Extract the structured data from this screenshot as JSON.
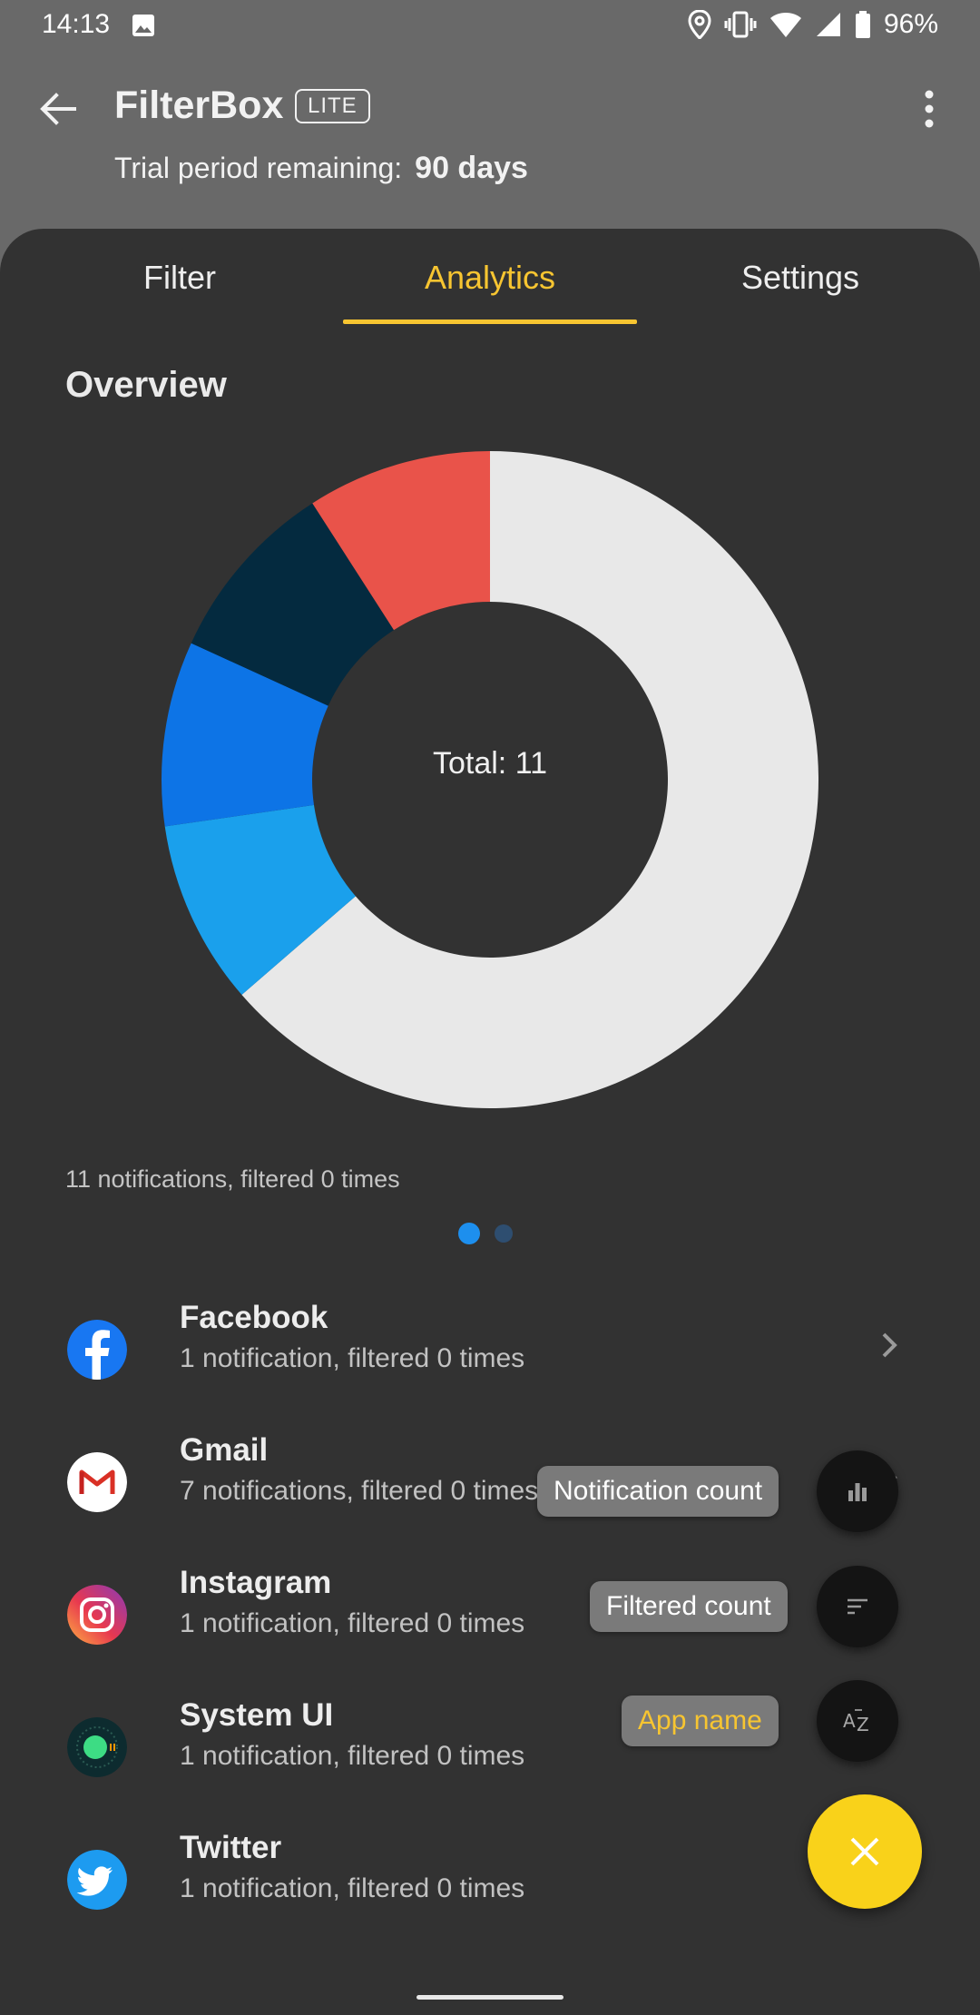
{
  "status_bar": {
    "time": "14:13",
    "battery": "96%"
  },
  "app_bar": {
    "title": "FilterBox",
    "badge": "LITE",
    "trial_label": "Trial period remaining:",
    "trial_value": "90 days"
  },
  "tabs": [
    {
      "label": "Filter",
      "active": false
    },
    {
      "label": "Analytics",
      "active": true
    },
    {
      "label": "Settings",
      "active": false
    }
  ],
  "overview": {
    "title": "Overview",
    "total_label": "Total: 11",
    "summary": "11 notifications, filtered 0 times"
  },
  "chart_data": {
    "type": "pie",
    "style": "donut",
    "categories": [
      "Gmail",
      "Twitter",
      "System UI",
      "Instagram",
      "Facebook"
    ],
    "values": [
      7,
      1,
      1,
      1,
      1
    ],
    "colors": [
      "#e8e8e8",
      "#1aa0ec",
      "#0d74e6",
      "#042a3f",
      "#e9534a"
    ],
    "center_label": "Total: 11"
  },
  "pager": {
    "count": 2,
    "active_index": 0
  },
  "apps": [
    {
      "name": "Facebook",
      "detail": "1 notification, filtered 0 times",
      "icon": "facebook-icon"
    },
    {
      "name": "Gmail",
      "detail": "7 notifications, filtered 0 times",
      "icon": "gmail-icon"
    },
    {
      "name": "Instagram",
      "detail": "1 notification, filtered 0 times",
      "icon": "instagram-icon"
    },
    {
      "name": "System UI",
      "detail": "1 notification, filtered 0 times",
      "icon": "system-ui-icon"
    },
    {
      "name": "Twitter",
      "detail": "1 notification, filtered 0 times",
      "icon": "twitter-icon"
    }
  ],
  "sort_menu": {
    "notification_count": "Notification count",
    "filtered_count": "Filtered count",
    "app_name": "App name"
  },
  "colors": {
    "accent": "#f7c531",
    "fab": "#f9d21a",
    "sheet": "#323232",
    "header": "#696969"
  }
}
